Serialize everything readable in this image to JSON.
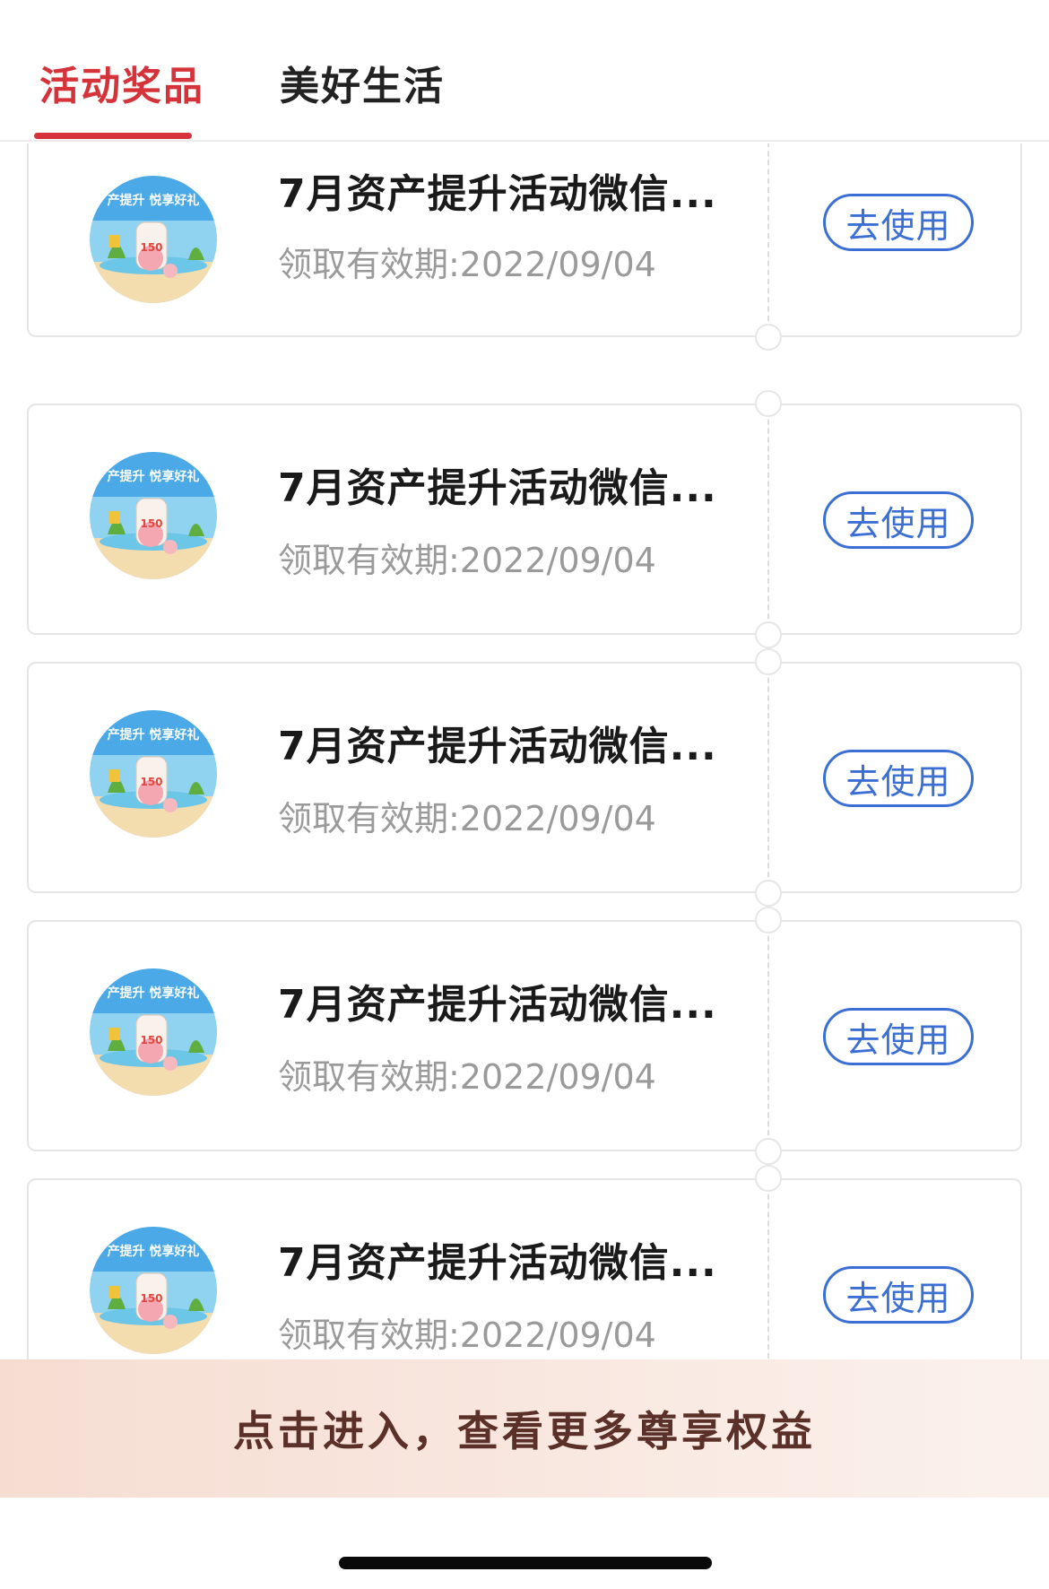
{
  "tabs": [
    {
      "label": "活动奖品",
      "active": true
    },
    {
      "label": "美好生活",
      "active": false
    }
  ],
  "coupons": [
    {
      "title": "7月资产提升活动微信...",
      "validity": "领取有效期:2022/09/04",
      "action": "去使用",
      "thumb_badge": "150"
    },
    {
      "title": "7月资产提升活动微信...",
      "validity": "领取有效期:2022/09/04",
      "action": "去使用",
      "thumb_badge": "150"
    },
    {
      "title": "7月资产提升活动微信...",
      "validity": "领取有效期:2022/09/04",
      "action": "去使用",
      "thumb_badge": "150"
    },
    {
      "title": "7月资产提升活动微信...",
      "validity": "领取有效期:2022/09/04",
      "action": "去使用",
      "thumb_badge": "150"
    },
    {
      "title": "7月资产提升活动微信...",
      "validity": "领取有效期:2022/09/04",
      "action": "去使用",
      "thumb_badge": "150"
    }
  ],
  "thumb_banner_text": "产提升 悦享好礼",
  "banner": {
    "label": "点击进入，查看更多尊享权益"
  },
  "colors": {
    "accent": "#d6323a",
    "button": "#3b6fd4",
    "banner_text": "#5a3028"
  }
}
